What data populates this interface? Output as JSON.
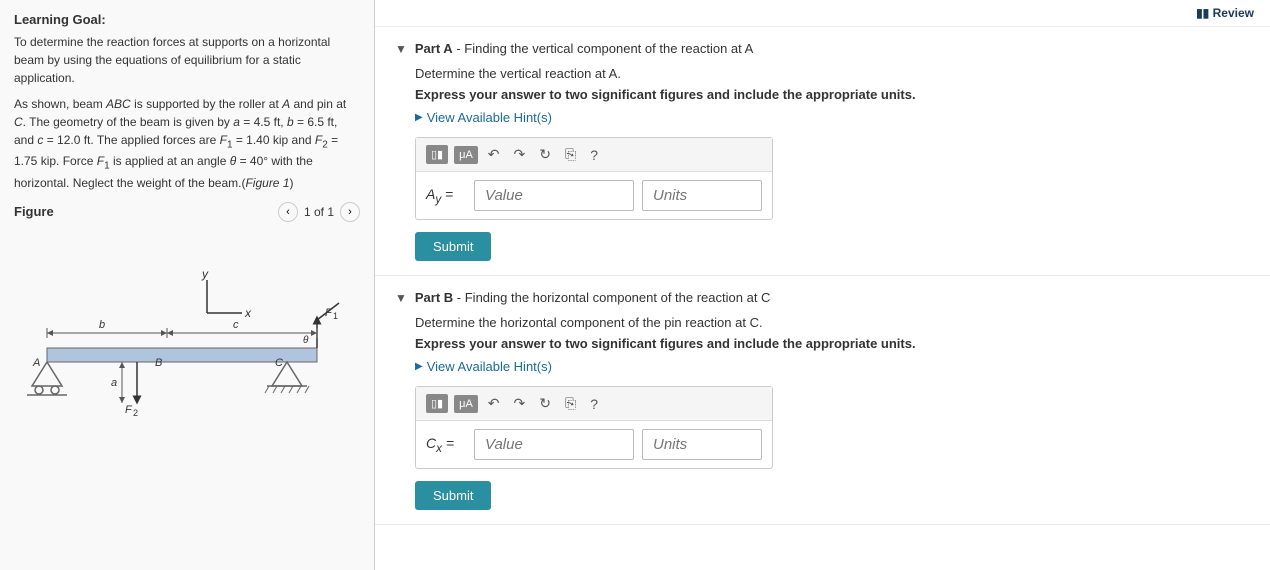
{
  "left": {
    "learning_goal_title": "Learning Goal:",
    "learning_goal_text": "To determine the reaction forces at supports on a horizontal beam by using the equations of equilibrium for a static application.",
    "problem_text": "As shown, beam ABC is supported by the roller at A and pin at C. The geometry of the beam is given by a = 4.5 ft, b = 6.5 ft, and c = 12.0 ft. The applied forces are F₁ = 1.40 kip and F₂ = 1.75 kip. Force F₁ is applied at an angle θ = 40° with the horizontal. Neglect the weight of the beam.(Figure 1)",
    "figure_title": "Figure",
    "figure_nav": "1 of 1"
  },
  "review_label": "Review",
  "parts": [
    {
      "id": "A",
      "title_bold": "Part A",
      "title_rest": " - Finding the vertical component of the reaction at A",
      "description": "Determine the vertical reaction at A.",
      "instruction": "Express your answer to two significant figures and include the appropriate units.",
      "hint_label": "View Available Hint(s)",
      "label": "Aᵧ",
      "value_placeholder": "Value",
      "units_placeholder": "Units",
      "submit_label": "Submit"
    },
    {
      "id": "B",
      "title_bold": "Part B",
      "title_rest": " - Finding the horizontal component of the reaction at C",
      "description": "Determine the horizontal component of the pin reaction at C.",
      "instruction": "Express your answer to two significant figures and include the appropriate units.",
      "hint_label": "View Available Hint(s)",
      "label": "Cₓ",
      "value_placeholder": "Value",
      "units_placeholder": "Units",
      "submit_label": "Submit"
    }
  ]
}
